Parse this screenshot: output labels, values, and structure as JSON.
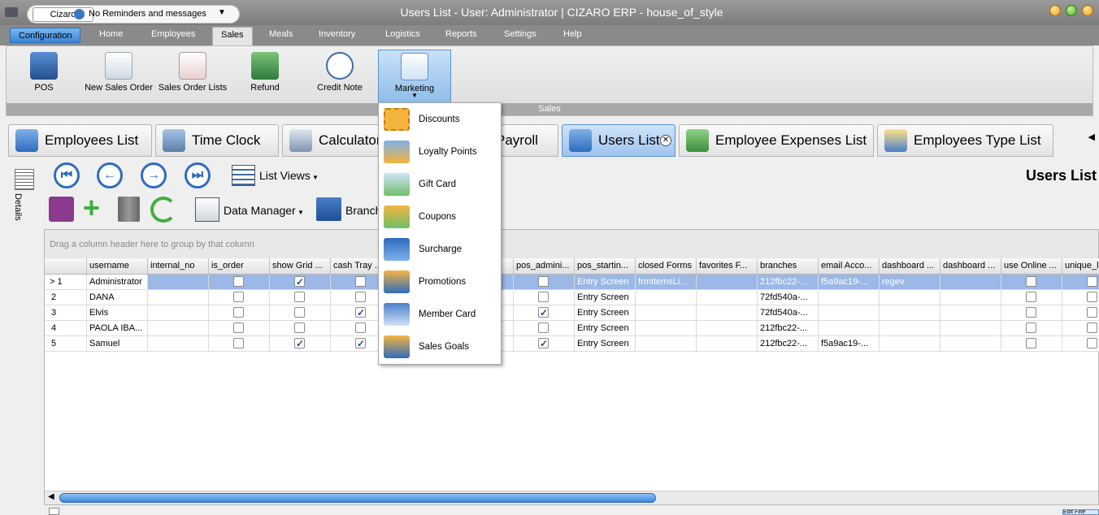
{
  "window": {
    "title": "Users List - User: Administrator | CIZARO ERP - house_of_style",
    "account_button": "Cizaro",
    "reminders": "No Reminders and messages"
  },
  "menu": {
    "tabs": [
      "Configuration",
      "Home",
      "Employees",
      "Sales",
      "Meals",
      "Inventory",
      "Logistics",
      "Reports",
      "Settings",
      "Help"
    ],
    "active": "Sales"
  },
  "ribbon": {
    "group_label": "Sales",
    "buttons": [
      {
        "label": "POS",
        "icon": "pos-register-icon"
      },
      {
        "label": "New Sales Order",
        "icon": "new-sales-order-icon"
      },
      {
        "label": "Sales Order Lists",
        "icon": "sales-order-lists-icon"
      },
      {
        "label": "Refund",
        "icon": "refund-icon"
      },
      {
        "label": "Credit Note",
        "icon": "credit-note-icon"
      },
      {
        "label": "Marketing",
        "icon": "marketing-icon"
      }
    ]
  },
  "marketing_menu": {
    "items": [
      {
        "label": "Discounts",
        "icon": "discount-50-icon"
      },
      {
        "label": "Loyalty Points",
        "icon": "loyalty-star-icon"
      },
      {
        "label": "Gift Card",
        "icon": "gift-card-icon"
      },
      {
        "label": "Coupons",
        "icon": "coupon-icon"
      },
      {
        "label": "Surcharge",
        "icon": "surcharge-icon"
      },
      {
        "label": "Promotions",
        "icon": "promotions-icon"
      },
      {
        "label": "Member Card",
        "icon": "member-card-icon"
      },
      {
        "label": "Sales Goals",
        "icon": "sales-goals-icon"
      }
    ]
  },
  "document_tabs": [
    {
      "label": "Employees List"
    },
    {
      "label": "Time Clock"
    },
    {
      "label": "Calculator"
    },
    {
      "label": "Payroll"
    },
    {
      "label": "Users List",
      "active": true
    },
    {
      "label": "Employee Expenses List"
    },
    {
      "label": "Employees Type List"
    }
  ],
  "toolbar": {
    "list_views": "List Views",
    "data_manager": "Data Manager",
    "branch": "Branch",
    "details": "Details",
    "page_title": "Users List"
  },
  "grid": {
    "group_hint": "Drag a column header here to group by that column",
    "columns": [
      "username",
      "internal_no",
      "is_order",
      "show Grid ...",
      "cash Tray ...",
      "pos_admini...",
      "pos_startin...",
      "closed Forms",
      "favorites F...",
      "branches",
      "email Acco...",
      "dashboard ...",
      "dashboard ...",
      "use Online ...",
      "unique_l"
    ],
    "rows": [
      {
        "num": "1",
        "username": "Administrator",
        "internal_no": "",
        "is_order": false,
        "show_grid": true,
        "cash_tray": false,
        "pos_admin": false,
        "pos_start": "Entry Screen",
        "closed_forms": "frmItemsLi...",
        "favorites": "",
        "branches": "212fbc22-...",
        "email": "f5a9ac19-...",
        "dash1": "regev",
        "dash2": "",
        "use_online": false,
        "unique": false
      },
      {
        "num": "2",
        "username": "DANA",
        "internal_no": "",
        "is_order": false,
        "show_grid": false,
        "cash_tray": false,
        "pos_admin": false,
        "pos_start": "Entry Screen",
        "closed_forms": "",
        "favorites": "",
        "branches": "72fd540a-...",
        "email": "",
        "dash1": "",
        "dash2": "",
        "use_online": false,
        "unique": false
      },
      {
        "num": "3",
        "username": "Elvis",
        "internal_no": "",
        "is_order": false,
        "show_grid": false,
        "cash_tray": true,
        "pos_admin": true,
        "pos_start": "Entry Screen",
        "closed_forms": "",
        "favorites": "",
        "branches": "72fd540a-...",
        "email": "",
        "dash1": "",
        "dash2": "",
        "use_online": false,
        "unique": false
      },
      {
        "num": "4",
        "username": "PAOLA IBA...",
        "internal_no": "",
        "is_order": false,
        "show_grid": false,
        "cash_tray": false,
        "pos_admin": false,
        "pos_start": "Entry Screen",
        "closed_forms": "",
        "favorites": "",
        "branches": "212fbc22-...",
        "email": "",
        "dash1": "",
        "dash2": "",
        "use_online": false,
        "unique": false
      },
      {
        "num": "5",
        "username": "Samuel",
        "internal_no": "",
        "is_order": false,
        "show_grid": true,
        "cash_tray": true,
        "pos_admin": true,
        "pos_start": "Entry Screen",
        "closed_forms": "",
        "favorites": "",
        "branches": "212fbc22-...",
        "email": "f5a9ac19-...",
        "dash1": "",
        "dash2": "",
        "use_online": false,
        "unique": false
      }
    ]
  },
  "footer": {
    "edit_filter": "Edit Filte"
  },
  "colors": {
    "selected_row": "#9bb8e6",
    "accent_blue": "#3b88d9",
    "title_bar": "#8a8a8a"
  }
}
